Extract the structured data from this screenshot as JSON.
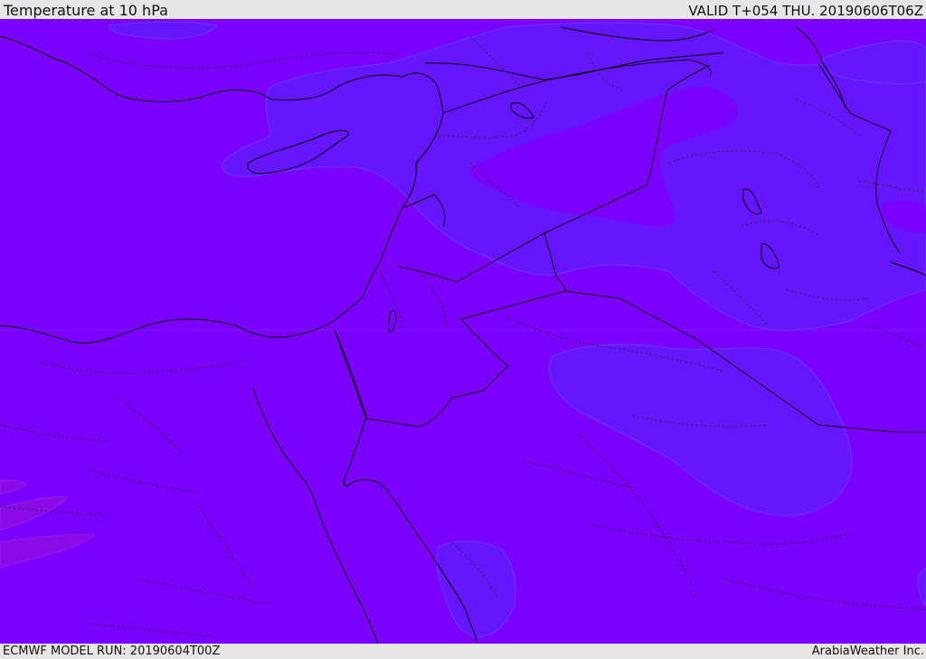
{
  "header": {
    "title": "Temperature at 10 hPa",
    "valid": "VALID T+054 THU. 20190606T06Z"
  },
  "footer": {
    "model_run": "ECMWF MODEL RUN: 20190604T00Z",
    "credit": "ArabiaWeather Inc."
  },
  "map": {
    "field": "temperature",
    "level": "10 hPa",
    "colors": {
      "base": "#7b00ff",
      "warmer_band": "#6615ff",
      "colder_band": "#8a0ae8",
      "coastline": "#000000",
      "border": "#1a1a1a"
    }
  }
}
